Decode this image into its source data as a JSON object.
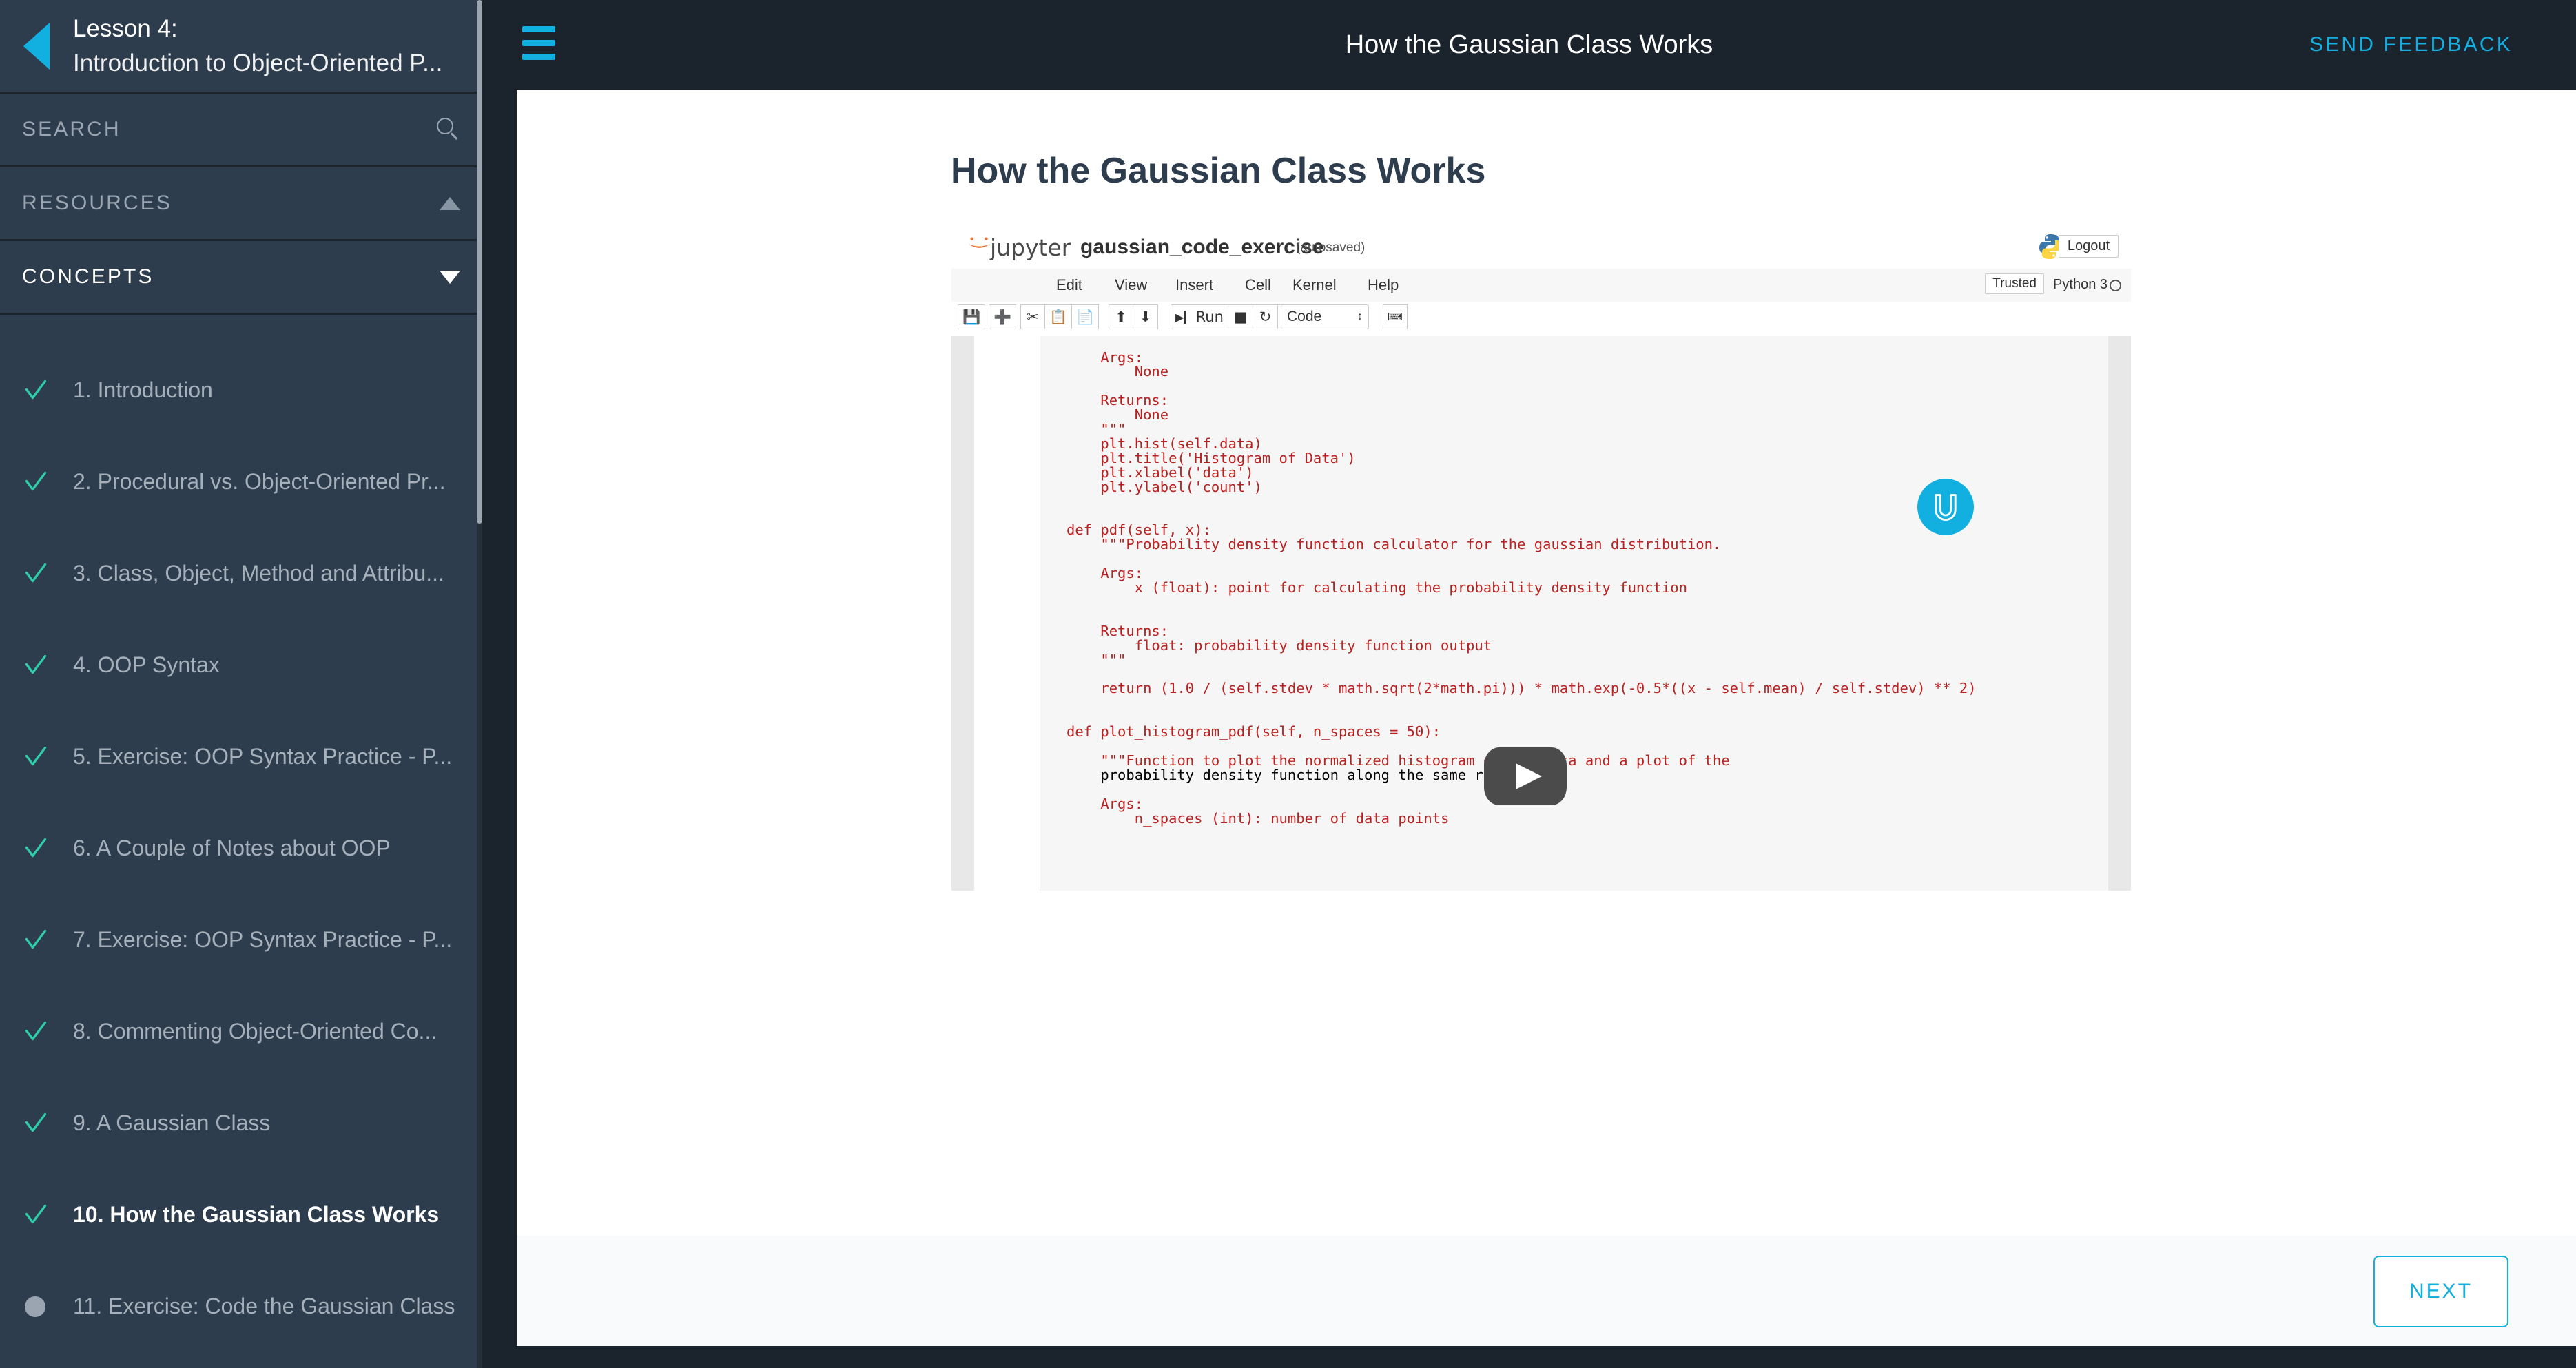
{
  "sidebar": {
    "back_arrow": "back-arrow",
    "lesson_number": "Lesson 4:",
    "lesson_title": "Introduction to Object-Oriented P...",
    "search_label": "SEARCH",
    "resources_label": "RESOURCES",
    "concepts_label": "CONCEPTS",
    "items": [
      {
        "label": "1. Introduction",
        "status": "complete",
        "current": false
      },
      {
        "label": "2. Procedural vs. Object-Oriented Pr...",
        "status": "complete",
        "current": false
      },
      {
        "label": "3. Class, Object, Method and Attribu...",
        "status": "complete",
        "current": false
      },
      {
        "label": "4. OOP Syntax",
        "status": "complete",
        "current": false
      },
      {
        "label": "5. Exercise: OOP Syntax Practice - P...",
        "status": "complete",
        "current": false
      },
      {
        "label": "6. A Couple of Notes about OOP",
        "status": "complete",
        "current": false
      },
      {
        "label": "7. Exercise: OOP Syntax Practice - P...",
        "status": "complete",
        "current": false
      },
      {
        "label": "8. Commenting Object-Oriented Co...",
        "status": "complete",
        "current": false
      },
      {
        "label": "9. A Gaussian Class",
        "status": "complete",
        "current": false
      },
      {
        "label": "10. How the Gaussian Class Works",
        "status": "complete",
        "current": true
      },
      {
        "label": "11. Exercise: Code the Gaussian Class",
        "status": "incomplete",
        "current": false
      }
    ]
  },
  "topbar": {
    "menu_icon": "hamburger-icon",
    "title": "How the Gaussian Class Works",
    "feedback_label": "SEND FEEDBACK"
  },
  "content": {
    "heading": "How the Gaussian Class Works"
  },
  "notebook": {
    "brand": "jupyter",
    "filename": "gaussian_code_exercise",
    "saved_state": "(autosaved)",
    "logout_label": "Logout",
    "menus": [
      "Edit",
      "View",
      "Insert",
      "Cell",
      "Kernel",
      "Help"
    ],
    "trusted_label": "Trusted",
    "kernel_label": "Python 3",
    "toolbar_buttons": [
      "save-icon",
      "add-icon",
      "cut-icon",
      "copy-icon",
      "paste-icon",
      "move-up-icon",
      "move-down-icon",
      "run-button",
      "stop-icon",
      "restart-icon",
      "restart-run-all-icon",
      "command-palette-icon"
    ],
    "run_label": "Run",
    "cell_type": "Code",
    "code_lines": [
      "    Args:",
      "        None",
      "",
      "    Returns:",
      "        None",
      "    \"\"\"",
      "    plt.hist(self.data)",
      "    plt.title('Histogram of Data')",
      "    plt.xlabel('data')",
      "    plt.ylabel('count')",
      "",
      "",
      "def pdf(self, x):",
      "    \"\"\"Probability density function calculator for the gaussian distribution.",
      "",
      "    Args:",
      "        x (float): point for calculating the probability density function",
      "",
      "",
      "    Returns:",
      "        float: probability density function output",
      "    \"\"\"",
      "",
      "    return (1.0 / (self.stdev * math.sqrt(2*math.pi))) * math.exp(-0.5*((x - self.mean) / self.stdev) ** 2)",
      "",
      "",
      "def plot_histogram_pdf(self, n_spaces = 50):",
      "",
      "    \"\"\"Function to plot the normalized histogram of the data and a plot of the",
      "    probability density function along the same range",
      "",
      "    Args:",
      "        n_spaces (int): number of data points"
    ],
    "play_button": "play-button"
  },
  "footer": {
    "next_label": "NEXT"
  },
  "colors": {
    "accent": "#12b0e0",
    "sidebar_bg": "#2e3d4d",
    "topbar_bg": "#1b242d",
    "check_green": "#2ecfa8",
    "heading": "#2e3d4d"
  }
}
